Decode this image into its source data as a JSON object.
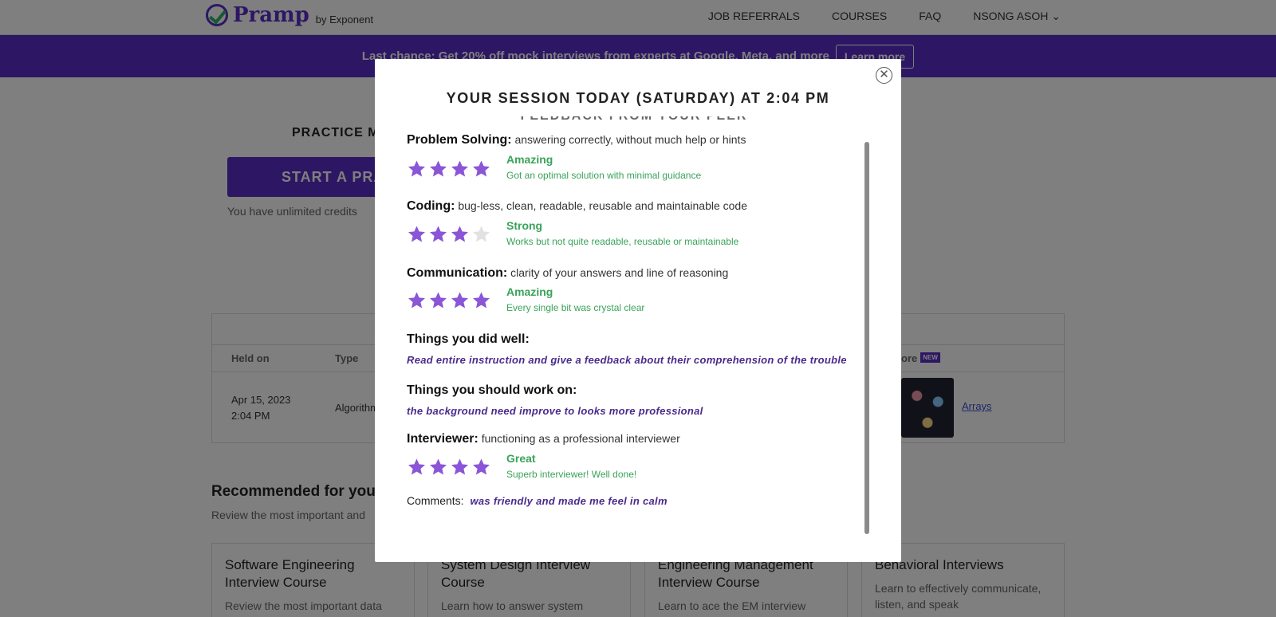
{
  "nav": {
    "logo": "Pramp",
    "logo_by": "by Exponent",
    "links": [
      "JOB REFERRALS",
      "COURSES",
      "FAQ"
    ],
    "user": "NSONG ASOH"
  },
  "promo": {
    "text": "Last chance: Get 20% off mock interviews from experts at Google, Meta, and more",
    "button": "Learn more"
  },
  "practice": {
    "title": "PRACTICE M",
    "start_button": "START A PRA",
    "credits": "You have unlimited credits"
  },
  "sessions": {
    "headers": {
      "held_on": "Held on",
      "type": "Type",
      "more": "ore",
      "new_badge": "NEW"
    },
    "row": {
      "date": "Apr 15, 2023",
      "time": "2:04 PM",
      "type": "Algorithm",
      "link": "Arrays"
    }
  },
  "recommended": {
    "title": "Recommended for you",
    "subtitle": "Review the most important and",
    "cards": [
      {
        "title": "Software Engineering Interview Course",
        "desc": "Review the most important data"
      },
      {
        "title": "System Design Interview Course",
        "desc": "Learn how to answer system"
      },
      {
        "title": "Engineering Management Interview Course",
        "desc": "Learn to ace the EM interview"
      },
      {
        "title": "Behavioral Interviews",
        "desc": "Learn to effectively communicate, listen, and speak"
      }
    ]
  },
  "modal": {
    "title": "YOUR SESSION TODAY (SATURDAY) AT 2:04 PM",
    "section_heading": "FEEDBACK FROM YOUR PEER",
    "close_symbol": "✕",
    "criteria": [
      {
        "label": "Problem Solving:",
        "desc": "answering correctly, without much help or hints",
        "stars": 4,
        "max": 4,
        "rating": "Amazing",
        "rating_desc": "Got an optimal solution with minimal guidance"
      },
      {
        "label": "Coding:",
        "desc": "bug-less, clean, readable, reusable and maintainable code",
        "stars": 3,
        "max": 4,
        "rating": "Strong",
        "rating_desc": "Works but not quite readable, reusable or maintainable"
      },
      {
        "label": "Communication:",
        "desc": "clarity of your answers and line of reasoning",
        "stars": 4,
        "max": 4,
        "rating": "Amazing",
        "rating_desc": "Every single bit was crystal clear"
      }
    ],
    "did_well": {
      "label": "Things you did well:",
      "text": "Read entire instruction and give a feedback about their comprehension of the trouble"
    },
    "work_on": {
      "label": "Things you should work on:",
      "text": "the background need improve to looks more professional"
    },
    "interviewer": {
      "label": "Interviewer:",
      "desc": "functioning as a professional interviewer",
      "stars": 4,
      "max": 4,
      "rating": "Great",
      "rating_desc": "Superb interviewer! Well done!"
    },
    "comments": {
      "label": "Comments:",
      "text": "was friendly and made me feel in calm"
    }
  },
  "colors": {
    "brand_purple": "#5b2fc9",
    "star_filled": "#8a55d6",
    "star_empty": "#e2e2e2",
    "rating_green": "#3aa35a",
    "feedback_text": "#4b2a8c"
  }
}
